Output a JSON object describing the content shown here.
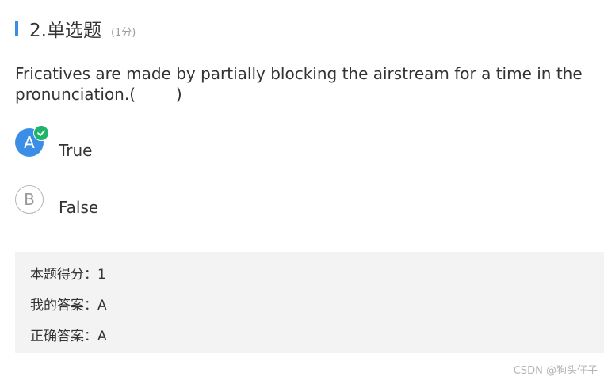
{
  "question": {
    "number_title": "2.单选题",
    "score": "(1分)",
    "text": "Fricatives are made by partially blocking the airstream for a time in the pronunciation.(        )"
  },
  "options": [
    {
      "letter": "A",
      "label": "True",
      "selected": true,
      "icon": "check-icon"
    },
    {
      "letter": "B",
      "label": "False",
      "selected": false
    }
  ],
  "result": {
    "score_line": "本题得分：1",
    "my_answer_line": "我的答案：A",
    "correct_answer_line": "正确答案：A"
  },
  "watermark": "CSDN @狗头仔子",
  "colors": {
    "accent": "#3a8ee6",
    "check": "#1fb36b",
    "result_bg": "#f3f3f3"
  }
}
